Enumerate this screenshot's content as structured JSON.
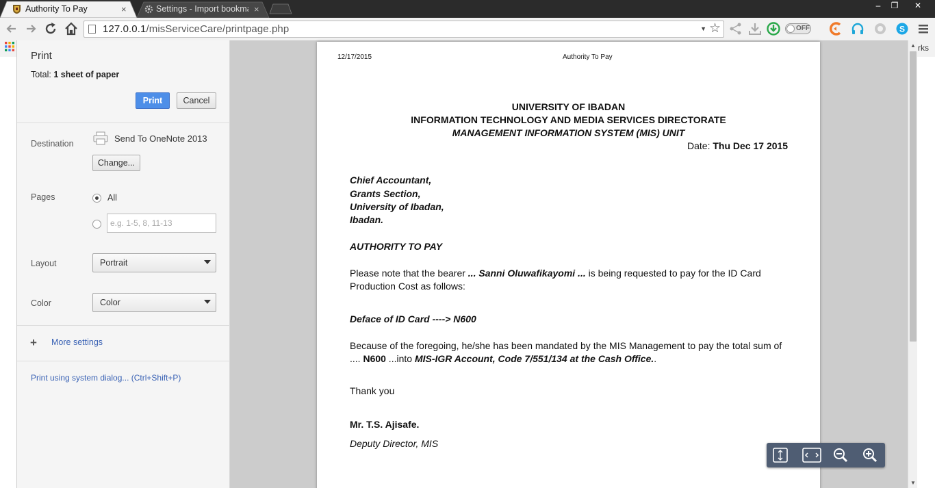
{
  "tabs": [
    {
      "label": "Authority To Pay",
      "close": "×"
    },
    {
      "label": "Settings - Import bookma",
      "close": "×"
    }
  ],
  "window_controls": {
    "minimize": "‒",
    "restore": "❐",
    "close": "✕"
  },
  "omnibox": {
    "host": "127.0.0.1",
    "path": "/misServiceCare/printpage.php"
  },
  "toolbar_toggle": "OFF",
  "bookmarks_tail": "rks",
  "print": {
    "title": "Print",
    "total_prefix": "Total: ",
    "total_value": "1 sheet of paper",
    "print_button": "Print",
    "cancel_button": "Cancel",
    "destination_label": "Destination",
    "destination_value": "Send To OneNote 2013",
    "change_button": "Change...",
    "pages_label": "Pages",
    "pages_all": "All",
    "pages_placeholder": "e.g. 1-5, 8, 11-13",
    "layout_label": "Layout",
    "layout_value": "Portrait",
    "color_label": "Color",
    "color_value": "Color",
    "more_settings": "More settings",
    "more_plus": "+",
    "system_dialog": "Print using system dialog... (Ctrl+Shift+P)"
  },
  "document": {
    "header_date": "12/17/2015",
    "header_title": "Authority To Pay",
    "org1": "UNIVERSITY OF IBADAN",
    "org2": "INFORMATION TECHNOLOGY AND MEDIA SERVICES DIRECTORATE",
    "org3": "MANAGEMENT INFORMATION SYSTEM (MIS) UNIT",
    "date_label": "Date: ",
    "date_value": "Thu Dec 17 2015",
    "addr1": "Chief Accountant,",
    "addr2": "Grants Section,",
    "addr3": "University of Ibadan,",
    "addr4": "Ibadan.",
    "heading": "AUTHORITY TO PAY",
    "p1_a": "Please note that the bearer ",
    "p1_name": "... Sanni Oluwafikayomi ...",
    "p1_b": " is being requested to pay for the ID Card Production Cost as follows:",
    "item": "Deface of ID Card ----> N600",
    "p2_a": "Because of the foregoing, he/she has been mandated by the MIS Management to pay the total sum of .... ",
    "p2_amount": "N600",
    "p2_b": " ...into ",
    "p2_account": "MIS-IGR Account, Code 7/551/134 at the Cash Office.",
    "p2_c": ".",
    "thanks": "Thank you",
    "signatory": "Mr. T.S. Ajisafe.",
    "signatory_title": "Deputy Director, MIS"
  }
}
